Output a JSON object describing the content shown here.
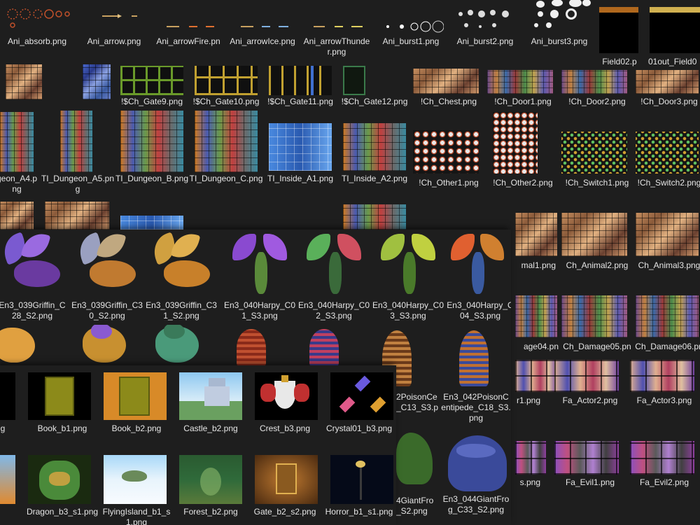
{
  "files": {
    "row1": [
      "Ani_absorb.png",
      "Ani_arrow.png",
      "Ani_arrowFire.pn",
      "Ani_arrowIce.png",
      "Ani_arrowThunder.png",
      "Ani_burst1.png",
      "Ani_burst2.png",
      "Ani_burst3.png",
      "Field02.p",
      "01out_Field0"
    ],
    "row2": [
      "!$Ch_Gate9.png",
      "!$Ch_Gate10.png",
      "!$Ch_Gate11.png",
      "!$Ch_Gate12.png",
      "!Ch_Chest.png",
      "!Ch_Door1.png",
      "!Ch_Door2.png",
      "!Ch_Door3.png"
    ],
    "row3": [
      "geon_A4.png",
      "TI_Dungeon_A5.png",
      "TI_Dungeon_B.png",
      "TI_Dungeon_C.png",
      "TI_Inside_A1.png",
      "TI_Inside_A2.png",
      "!Ch_Other1.png",
      "!Ch_Other2.png",
      "!Ch_Switch1.png",
      "!Ch_Switch2.png"
    ],
    "row4_right": [
      "mal1.png",
      "Ch_Animal2.png",
      "Ch_Animal3.png"
    ],
    "row5": [
      "En3_039Griffin_C28_S2.png",
      "En3_039Griffin_C30_S2.png",
      "En3_039Griffin_C31_S2.png",
      "En3_040Harpy_C01_S3.png",
      "En3_040Harpy_C02_S3.png",
      "En3_040Harpy_C03_S3.png",
      "En3_040Harpy_C04_S3.png"
    ],
    "row6_right": [
      "age04.pn",
      "Ch_Damage05.pn",
      "Ch_Damage06.pn"
    ],
    "row7_mid": [
      "2PoisonCe_C13_S3.p",
      "En3_042PoisonCentipede_C18_S3.png"
    ],
    "row7_right": [
      "r1.png",
      "Fa_Actor2.png",
      "Fa_Actor3.png"
    ],
    "row7_left": [
      "g",
      "Book_b1.png",
      "Book_b2.png",
      "Castle_b2.png",
      "Crest_b3.png",
      "Crystal01_b3.png"
    ],
    "row8_left": [
      "Dragon_b3_s1.png",
      "FlyingIsland_b1_s1.png",
      "Forest_b2.png",
      "Gate_b2_s2.png",
      "Horror_b1_s1.png"
    ],
    "row8_mid": [
      "4GiantFro_S2.png",
      "En3_044GiantFrog_C33_S2.png"
    ],
    "row8_right": [
      "s.png",
      "Fa_Evil1.png",
      "Fa_Evil2.png"
    ]
  },
  "colors": {
    "background": "#1e1e1e",
    "label_text": "#e6e6e6",
    "book_olive": "#8c8a1a",
    "book_orange": "#d88a28",
    "sky_blue": "#8ec8f0",
    "forest_green": "#2f6a3a"
  },
  "icons": {
    "thumb_type": "image-thumbnail"
  }
}
